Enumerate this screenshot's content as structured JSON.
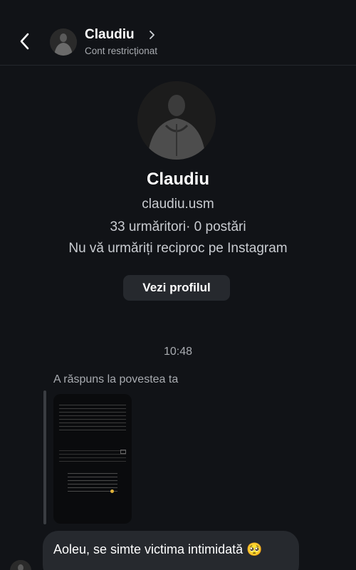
{
  "header": {
    "name": "Claudiu",
    "status": "Cont restricționat",
    "back_icon": "chevron-left-icon",
    "chevron_icon": "chevron-right-icon"
  },
  "profile": {
    "name": "Claudiu",
    "handle": "claudiu.usm",
    "stats": "33 urmăritori· 0 postări",
    "mutual": "Nu vă urmăriți reciproc pe Instagram",
    "view_profile_label": "Vezi profilul"
  },
  "conversation": {
    "timestamp": "10:48",
    "reply_label": "A răspuns la povestea ta",
    "message_text": "Aoleu, se simte victima intimidată 🥺"
  },
  "colors": {
    "background": "#111317",
    "bubble": "#26292e",
    "secondary_text": "#a8abb0"
  }
}
